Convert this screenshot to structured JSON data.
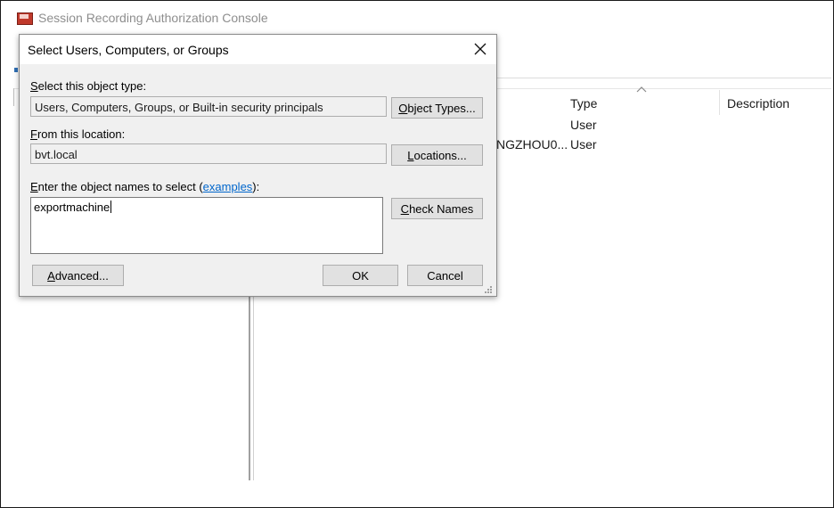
{
  "app": {
    "title": "Session Recording Authorization Console",
    "columns": {
      "type": "Type",
      "description": "Description"
    },
    "rows": [
      {
        "name": "",
        "type": "User"
      },
      {
        "name": "NGZHOU0...",
        "type": "User"
      }
    ]
  },
  "dialog": {
    "title": "Select Users, Computers, or Groups",
    "object_type": {
      "label_accel": "S",
      "label_rest": "elect this object type:",
      "value": "Users, Computers, Groups, or Built-in security principals",
      "button_accel": "O",
      "button_rest": "bject Types..."
    },
    "location": {
      "label_accel": "F",
      "label_rest": "rom this location:",
      "value": "bvt.local",
      "button_accel": "L",
      "button_rest": "ocations..."
    },
    "names": {
      "label_accel": "E",
      "label_rest": "nter the object names to select (",
      "link": "examples",
      "label_end": "):",
      "value": "exportmachine",
      "check_accel": "C",
      "check_rest": "heck Names"
    },
    "advanced_accel": "A",
    "advanced_rest": "dvanced...",
    "ok": "OK",
    "cancel": "Cancel"
  }
}
